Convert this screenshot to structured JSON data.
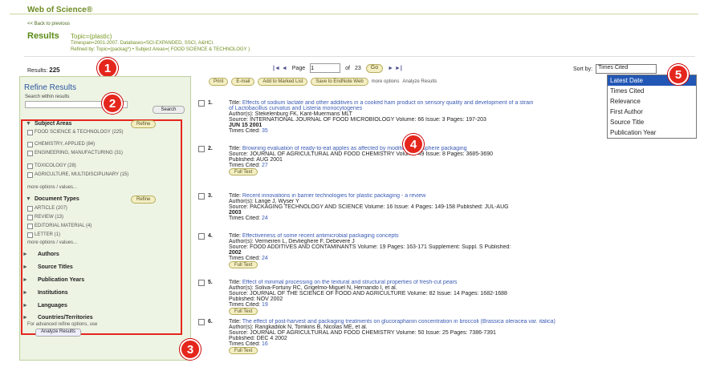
{
  "header": {
    "logo": "Web of Science®",
    "back_link": "<< Back to previous"
  },
  "results_header": {
    "title": "Results",
    "topic": "Topic=(plastic)",
    "meta_1": "Timespan=2001-2007. Databases=SCI-EXPANDED, SSCI, A&HCI.",
    "meta_2": "Refined by: Topic=(packag*) • Subject Areas=( FOOD SCIENCE & TECHNOLOGY )"
  },
  "results_count": {
    "label": "Results:",
    "value": "225"
  },
  "pager": {
    "first_prev": "|◄ ◄",
    "page_label": "Page",
    "page_value": "1",
    "of_label": "of",
    "total_pages": "23",
    "go": "Go",
    "next_last": "► ►|"
  },
  "sort": {
    "label": "Sort by:",
    "selected": "Times Cited",
    "options": [
      "Latest Date",
      "Times Cited",
      "Relevance",
      "First Author",
      "Source Title",
      "Publication Year"
    ]
  },
  "badges": [
    "1",
    "2",
    "3",
    "4",
    "5"
  ],
  "refine": {
    "title": "Refine Results",
    "search_label": "Search within results",
    "search_btn": "Search",
    "subject_areas": {
      "label": "Subject Areas",
      "refine": "Refine",
      "options": [
        "FOOD SCIENCE & TECHNOLOGY (225)",
        "CHEMISTRY, APPLIED (84)",
        "ENGINEERING, MANUFACTURING (31)",
        "TOXICOLOGY (28)",
        "AGRICULTURE, MULTIDISCIPLINARY (15)"
      ],
      "more": "more options / values..."
    },
    "document_types": {
      "label": "Document Types",
      "refine": "Refine",
      "options": [
        "ARTICLE (207)",
        "REVIEW (13)",
        "EDITORIAL MATERIAL (4)",
        "LETTER (1)"
      ],
      "more": "more options / values..."
    },
    "collapsed": [
      "Authors",
      "Source Titles",
      "Publication Years",
      "Institutions",
      "Languages",
      "Countries/Territories"
    ],
    "advanced_note": "For advanced refine options, use",
    "analyze_btn": "Analyze Results"
  },
  "toolbar": {
    "print": "Print",
    "email": "E-mail",
    "marked": "Add to Marked List",
    "save": "Save to EndNote Web",
    "more": "more options",
    "analyze": "Analyze Results"
  },
  "records": [
    {
      "num": "1.",
      "title_label": "Title:",
      "title": "Effects of sodium lactate and other additives in a cooked ham product on sensory quality and development of a strain of Lactobacillus curvatus and Listeria monocytogenes",
      "authors": "Author(s): Stekelenburg FK, Kant-Muermans MLT",
      "source": "Source: INTERNATIONAL JOURNAL OF FOOD MICROBIOLOGY  Volume: 66  Issue: 3  Pages: 197-203",
      "published": "JUN 15 2001",
      "cited_label": "Times Cited:",
      "cited": "35"
    },
    {
      "num": "2.",
      "title_label": "Title:",
      "title": "Browning evaluation of ready-to-eat apples as affected by modified atmosphere packaging",
      "authors": "",
      "source": "Source: JOURNAL OF AGRICULTURAL AND FOOD CHEMISTRY  Volume: 49  Issue: 8  Pages: 3685-3690",
      "published": "Published: AUG 2001",
      "cited_label": "Times Cited:",
      "cited": "27",
      "fulltext": "Full Text"
    },
    {
      "num": "3.",
      "title_label": "Title:",
      "title": "Recent innovations in barrier technologies for plastic packaging - a review",
      "authors": "Author(s): Lange J, Wyser Y",
      "source": "Source: PACKAGING TECHNOLOGY AND SCIENCE  Volume: 16  Issue: 4  Pages: 149-158  Published: JUL-AUG",
      "published": "2003",
      "cited_label": "Times Cited:",
      "cited": "24"
    },
    {
      "num": "4.",
      "title_label": "Title:",
      "title": "Effectiveness of some recent antimicrobial packaging concepts",
      "authors": "Author(s): Vermeiren L, Devlieghere F, Debevere J",
      "source": "Source: FOOD ADDITIVES AND CONTAMINANTS  Volume: 19  Pages: 163-171  Supplement: Suppl. S  Published:",
      "published": "2002",
      "cited_label": "Times Cited:",
      "cited": "24",
      "fulltext": "Full Text"
    },
    {
      "num": "5.",
      "title_label": "Title:",
      "title": "Effect of minimal processing on the textural and structural properties of fresh-cut pears",
      "authors": "Author(s): Soliva-Fortuny RC, Grigelmo-Miguel N, Hernando I, et al.",
      "source": "Source: JOURNAL OF THE SCIENCE OF FOOD AND AGRICULTURE  Volume: 82  Issue: 14  Pages: 1682-1688",
      "published": "Published: NOV 2002",
      "cited_label": "Times Cited:",
      "cited": "19",
      "fulltext": "Full Text"
    },
    {
      "num": "6.",
      "title_label": "Title:",
      "title": "The effect of post-harvest and packaging treatments on glucoraphanin concentration in broccoli (Brassica oleracea var. italica)",
      "authors": "Author(s): Rangkadilok N, Tomkins B, Nicolas ME, et al.",
      "source": "Source: JOURNAL OF AGRICULTURAL AND FOOD CHEMISTRY  Volume: 50  Issue: 25  Pages: 7386-7391",
      "published": "Published: DEC 4 2002",
      "cited_label": "Times Cited:",
      "cited": "16",
      "fulltext": "Full Text"
    }
  ]
}
